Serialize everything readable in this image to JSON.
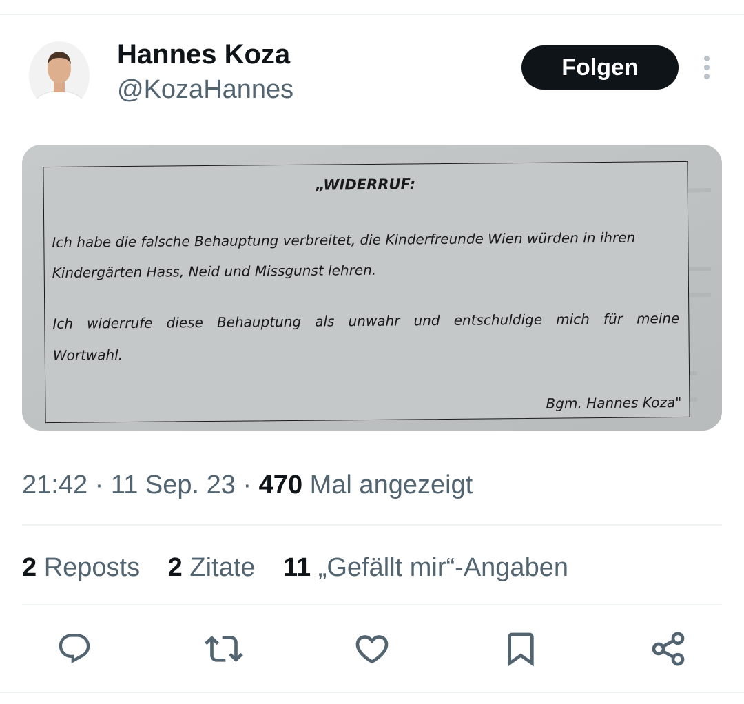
{
  "author": {
    "display_name": "Hannes Koza",
    "handle": "@KozaHannes"
  },
  "follow_label": "Folgen",
  "document": {
    "title": "„WIDERRUF:",
    "line1": "Ich habe die falsche Behauptung verbreitet, die Kinderfreunde Wien würden in ihren",
    "line2": "Kindergärten Hass, Neid und Missgunst lehren.",
    "line3": "Ich widerrufe diese Behauptung als unwahr und entschuldige mich für meine",
    "line4": "Wortwahl.",
    "signature": "Bgm. Hannes Koza\""
  },
  "meta": {
    "time": "21:42",
    "date": "11 Sep. 23",
    "separator": "·",
    "views_count": "470",
    "views_label": "Mal angezeigt"
  },
  "stats": {
    "reposts_count": "2",
    "reposts_label": "Reposts",
    "quotes_count": "2",
    "quotes_label": "Zitate",
    "likes_count": "11",
    "likes_label": "„Gefällt mir“-Angaben"
  },
  "actions": [
    "reply-icon",
    "repost-icon",
    "like-icon",
    "bookmark-icon",
    "share-icon"
  ],
  "colors": {
    "text_primary": "#0f1419",
    "text_secondary": "#536471",
    "divider": "#eff3f4",
    "button_bg": "#0f1419"
  }
}
